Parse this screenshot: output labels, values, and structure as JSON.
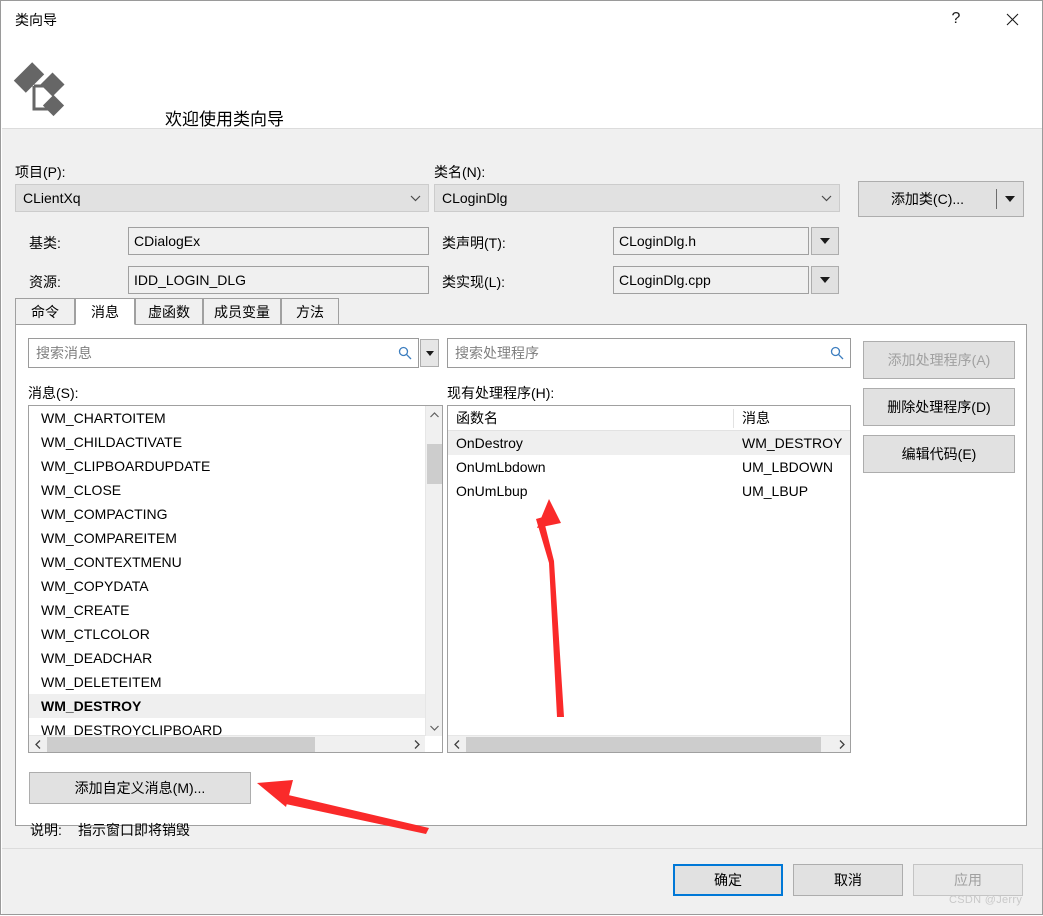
{
  "window": {
    "title": "类向导",
    "help_icon": "question-mark-icon",
    "close_icon": "close-icon"
  },
  "banner": {
    "icon": "class-wizard-icon",
    "title": "欢迎使用类向导"
  },
  "form": {
    "project_label": "项目(P):",
    "project_value": "CLientXq",
    "class_name_label": "类名(N):",
    "class_name_value": "CLoginDlg",
    "base_class_label": "基类:",
    "base_class_value": "CDialogEx",
    "class_decl_label": "类声明(T):",
    "class_decl_value": "CLoginDlg.h",
    "resource_label": "资源:",
    "resource_value": "IDD_LOGIN_DLG",
    "class_impl_label": "类实现(L):",
    "class_impl_value": "CLoginDlg.cpp",
    "add_class_button": "添加类(C)...",
    "add_class_arrow_icon": "chevron-down-icon"
  },
  "tabs": [
    {
      "label": "命令",
      "selected": false
    },
    {
      "label": "消息",
      "selected": true
    },
    {
      "label": "虚函数",
      "selected": false
    },
    {
      "label": "成员变量",
      "selected": false
    },
    {
      "label": "方法",
      "selected": false
    }
  ],
  "search": {
    "messages_placeholder": "搜索消息",
    "messages_icon": "search-icon",
    "messages_dropdown_icon": "chevron-down-icon",
    "handlers_placeholder": "搜索处理程序",
    "handlers_icon": "search-icon"
  },
  "messages_panel": {
    "label": "消息(S):",
    "items": [
      {
        "name": "WM_CHARTOITEM",
        "selected": false
      },
      {
        "name": "WM_CHILDACTIVATE",
        "selected": false
      },
      {
        "name": "WM_CLIPBOARDUPDATE",
        "selected": false
      },
      {
        "name": "WM_CLOSE",
        "selected": false
      },
      {
        "name": "WM_COMPACTING",
        "selected": false
      },
      {
        "name": "WM_COMPAREITEM",
        "selected": false
      },
      {
        "name": "WM_CONTEXTMENU",
        "selected": false
      },
      {
        "name": "WM_COPYDATA",
        "selected": false
      },
      {
        "name": "WM_CREATE",
        "selected": false
      },
      {
        "name": "WM_CTLCOLOR",
        "selected": false
      },
      {
        "name": "WM_DEADCHAR",
        "selected": false
      },
      {
        "name": "WM_DELETEITEM",
        "selected": false
      },
      {
        "name": "WM_DESTROY",
        "selected": true
      },
      {
        "name": "WM_DESTROYCLIPBOARD",
        "selected": false
      }
    ],
    "scroll_up_icon": "chevron-up-icon",
    "scroll_down_icon": "chevron-down-icon",
    "scroll_left_icon": "chevron-left-icon",
    "scroll_right_icon": "chevron-right-icon"
  },
  "handlers_panel": {
    "label": "现有处理程序(H):",
    "columns": [
      "函数名",
      "消息"
    ],
    "rows": [
      {
        "function": "OnDestroy",
        "message": "WM_DESTROY",
        "selected": true
      },
      {
        "function": "OnUmLbdown",
        "message": "UM_LBDOWN",
        "selected": false
      },
      {
        "function": "OnUmLbup",
        "message": "UM_LBUP",
        "selected": false
      }
    ],
    "scroll_left_icon": "chevron-left-icon",
    "scroll_right_icon": "chevron-right-icon"
  },
  "side_buttons": [
    {
      "label": "添加处理程序(A)",
      "disabled": true
    },
    {
      "label": "删除处理程序(D)",
      "disabled": false
    },
    {
      "label": "编辑代码(E)",
      "disabled": false
    }
  ],
  "bottom": {
    "add_custom_message_button": "添加自定义消息(M)...",
    "description_label": "说明:",
    "description_text": "指示窗口即将销毁"
  },
  "footer": {
    "ok": "确定",
    "cancel": "取消",
    "apply": "应用",
    "apply_disabled": true
  },
  "watermark": "CSDN @Jerry",
  "annotations": {
    "arrow_color": "#fa2a2a",
    "arrow_vertical_name": "red-arrow-pointing-to-handler-list",
    "arrow_diagonal_name": "red-arrow-pointing-to-add-custom-message"
  }
}
